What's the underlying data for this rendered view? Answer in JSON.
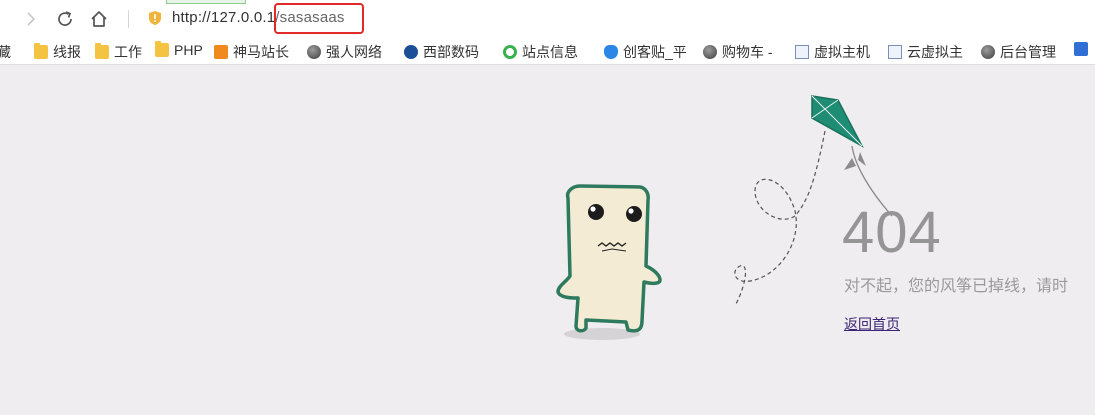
{
  "browser": {
    "url_host": "http://127.0.0.1",
    "url_path": "/sasasaas",
    "bookmarks": [
      {
        "label": "藏",
        "icon": "none-icon"
      },
      {
        "label": "线报",
        "icon": "folder-icon"
      },
      {
        "label": "工作",
        "icon": "folder-icon"
      },
      {
        "label": "PHP",
        "icon": "folder-icon"
      },
      {
        "label": "神马站长",
        "icon": "shenma-icon"
      },
      {
        "label": "强人网络",
        "icon": "globe-icon"
      },
      {
        "label": "西部数码",
        "icon": "west-digital-icon"
      },
      {
        "label": "站点信息",
        "icon": "site-info-icon"
      },
      {
        "label": "创客贴_平",
        "icon": "chuangke-icon"
      },
      {
        "label": "购物车 -",
        "icon": "globe-icon"
      },
      {
        "label": "虚拟主机",
        "icon": "host-icon"
      },
      {
        "label": "云虚拟主",
        "icon": "host-icon"
      },
      {
        "label": "后台管理",
        "icon": "globe-icon"
      }
    ]
  },
  "error_page": {
    "code": "404",
    "message": "对不起，您的风筝已掉线，请时",
    "home_link": "返回首页"
  },
  "colors": {
    "kite": "#1f8c74",
    "character_outline": "#2e7a5e",
    "character_fill": "#f3ebd3",
    "highlight_box": "#e02a2a",
    "page_bg": "#efedef"
  }
}
